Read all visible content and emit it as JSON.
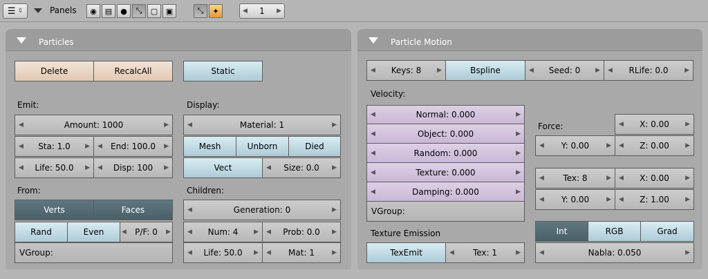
{
  "header": {
    "panels_label": "Panels",
    "page_number": "1"
  },
  "particles": {
    "title": "Particles",
    "delete": "Delete",
    "recalc_all": "RecalcAll",
    "static": "Static",
    "emit_label": "Emit:",
    "amount": "Amount: 1000",
    "sta": "Sta: 1.0",
    "end": "End: 100.0",
    "life": "Life: 50.0",
    "disp": "Disp: 100",
    "display_label": "Display:",
    "material": "Material: 1",
    "mesh": "Mesh",
    "unborn": "Unborn",
    "died": "Died",
    "vect": "Vect",
    "size": "Size: 0.0",
    "from_label": "From:",
    "verts": "Verts",
    "faces": "Faces",
    "rand": "Rand",
    "even": "Even",
    "pf": "P/F: 0",
    "vgroup": "VGroup:",
    "children_label": "Children:",
    "generation": "Generation: 0",
    "num": "Num: 4",
    "prob": "Prob: 0.0",
    "child_life": "Life: 50.0",
    "mat": "Mat: 1"
  },
  "motion": {
    "title": "Particle Motion",
    "keys": "Keys: 8",
    "bspline": "Bspline",
    "seed": "Seed: 0",
    "rlife": "RLife: 0.0",
    "velocity_label": "Velocity:",
    "normal": "Normal: 0.000",
    "object": "Object: 0.000",
    "random": "Random: 0.000",
    "texture": "Texture: 0.000",
    "damping": "Damping: 0.000",
    "vgroup": "VGroup:",
    "force_label": "Force:",
    "force_x": "X: 0.00",
    "force_y": "Y: 0.00",
    "force_z": "Z: 0.00",
    "tex": "Tex: 8",
    "tex_x": "X: 0.00",
    "tex_y": "Y: 0.00",
    "tex_z": "Z: 1.00",
    "texture_emission_label": "Texture Emission",
    "texemit": "TexEmit",
    "tex1": "Tex: 1",
    "int": "Int",
    "rgb": "RGB",
    "grad": "Grad",
    "nabla": "Nabla: 0.050"
  }
}
